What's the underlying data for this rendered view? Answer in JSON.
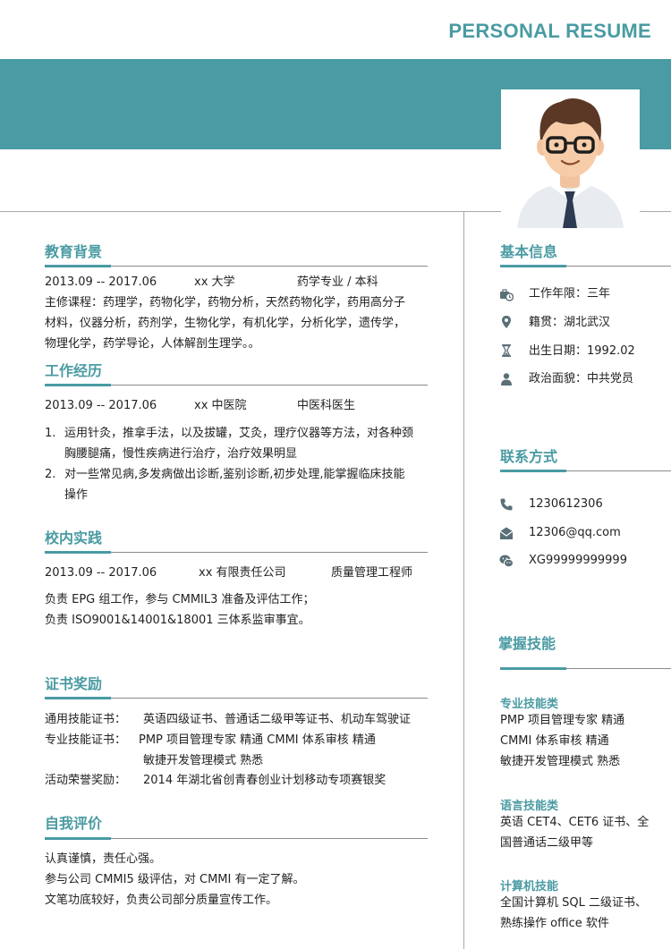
{
  "header": {
    "title": "PERSONAL RESUME"
  },
  "education": {
    "title": "教育背景",
    "period": "2013.09 -- 2017.06",
    "school": "xx 大学",
    "major": "药学专业  /  本科",
    "courses_lines": [
      "主修课程：药理学，药物化学，药物分析，天然药物化学，药用高分子",
      "材料，仪器分析，药剂学，生物化学，有机化学，分析化学，遗传学，",
      "物理化学，药学导论，人体解剖生理学。。"
    ]
  },
  "work": {
    "title": "工作经历",
    "period": "2013.09 -- 2017.06",
    "org": "xx 中医院",
    "role": "中医科医生",
    "items": [
      {
        "num": "1.",
        "lines": [
          "运用针灸，推拿手法，以及拔罐，艾灸，理疗仪器等方法，对各种颈",
          "胸腰腿痛，慢性疾病进行治疗，治疗效果明显"
        ]
      },
      {
        "num": "2.",
        "lines": [
          "对一些常见病,多发病做出诊断,鉴别诊断,初步处理,能掌握临床技能",
          "操作"
        ]
      }
    ]
  },
  "campus": {
    "title": "校内实践",
    "period": "2013.09 -- 2017.06",
    "org": "xx 有限责任公司",
    "role": "质量管理工程师",
    "lines": [
      "负责 EPG 组工作，参与 CMMIL3 准备及评估工作；",
      "负责 ISO9001&14001&18001 三体系监审事宜。"
    ]
  },
  "certs": {
    "title": "证书奖励",
    "rows": [
      {
        "label": "通用技能证书：",
        "lines": [
          "英语四级证书、普通话二级甲等证书、机动车驾驶证"
        ]
      },
      {
        "label": "专业技能证书：",
        "lines": [
          "PMP 项目管理专家    精通        CMMI 体系审核    精通",
          "敏捷开发管理模式    熟悉"
        ]
      },
      {
        "label": "活动荣誉奖励：",
        "lines": [
          "2014 年湖北省创青春创业计划移动专项赛银奖"
        ]
      }
    ]
  },
  "self": {
    "title": "自我评价",
    "lines": [
      "认真谨慎，责任心强。",
      "参与公司 CMMI5 级评估，对 CMMI 有一定了解。",
      "文笔功底较好，负责公司部分质量宣传工作。"
    ]
  },
  "basic": {
    "title": "基本信息",
    "items": [
      {
        "icon": "briefcase-clock-icon",
        "text": "工作年限：三年"
      },
      {
        "icon": "location-pin-icon",
        "text": "籍贯：湖北武汉"
      },
      {
        "icon": "hourglass-icon",
        "text": "出生日期：1992.02"
      },
      {
        "icon": "person-icon",
        "text": "政治面貌：中共党员"
      }
    ]
  },
  "contact": {
    "title": "联系方式",
    "items": [
      {
        "icon": "phone-icon",
        "text": "1230612306"
      },
      {
        "icon": "email-icon",
        "text": "12306@qq.com"
      },
      {
        "icon": "wechat-icon",
        "text": "XG99999999999"
      }
    ]
  },
  "skills": {
    "title": "掌握技能",
    "groups": [
      {
        "title": "专业技能类",
        "lines": [
          "PMP 项目管理专家    精通",
          "CMMI 体系审核    精通",
          "敏捷开发管理模式    熟悉"
        ]
      },
      {
        "title": "语言技能类",
        "lines": [
          "英语 CET4、CET6 证书、全",
          "国普通话二级甲等"
        ]
      },
      {
        "title": "计算机技能",
        "lines": [
          "全国计算机 SQL 二级证书、",
          "熟练操作 office 软件"
        ]
      }
    ]
  },
  "colors": {
    "accent": "#4a9ba3",
    "rule": "#8a8a8a",
    "icon": "#5a6f78"
  }
}
